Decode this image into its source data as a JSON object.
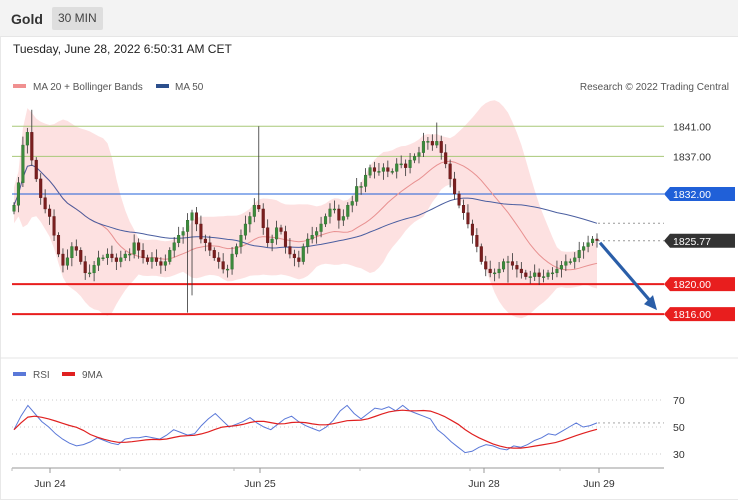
{
  "header": {
    "symbol": "Gold",
    "timeframe": "30 MIN",
    "timestamp": "Tuesday, June 28, 2022 6:50:31 AM CET"
  },
  "legend": {
    "ma20": "MA 20 + Bollinger Bands",
    "ma50": "MA 50",
    "credit": "Research © 2022 Trading Central",
    "rsi": "RSI",
    "rsi_ma": "9MA"
  },
  "colors": {
    "bands_fill": "#fddcdc",
    "ma20": "#e89090",
    "ma50": "#4a5ea0",
    "resistance_green": "#a8c878",
    "blue_level": "#2060d8",
    "support_red": "#e81e1e",
    "current": "#333333",
    "candle": "#7a1f1f",
    "rsi": "#5a78d8",
    "rsi_ma": "#e02020",
    "arrow": "#2a5ea8"
  },
  "chart_data": [
    {
      "type": "candlestick",
      "title": "Gold",
      "timeframe": "30 MIN",
      "x_ticks": [
        "Jun 24",
        "Jun 25",
        "Jun 28",
        "Jun 29"
      ],
      "ylim": [
        1811.5,
        1844.5
      ],
      "levels": [
        {
          "value": 1841.0,
          "label": "1841.00",
          "style": "green"
        },
        {
          "value": 1837.0,
          "label": "1837.00",
          "style": "green"
        },
        {
          "value": 1832.0,
          "label": "1832.00",
          "style": "blue"
        },
        {
          "value": 1825.77,
          "label": "1825.77",
          "style": "current"
        },
        {
          "value": 1820.0,
          "label": "1820.00",
          "style": "red"
        },
        {
          "value": 1816.0,
          "label": "1816.00",
          "style": "red"
        }
      ],
      "forecast_arrow": {
        "from": 1825.77,
        "to": 1816.0,
        "direction": "down"
      },
      "close_series": [
        1830.5,
        1833.5,
        1838.5,
        1840.2,
        1836.5,
        1834.0,
        1831.5,
        1830.0,
        1829.0,
        1826.5,
        1824.0,
        1822.5,
        1823.5,
        1825.0,
        1824.5,
        1823.0,
        1821.5,
        1821.5,
        1822.5,
        1823.5,
        1823.5,
        1824.0,
        1823.5,
        1823.0,
        1823.5,
        1824.0,
        1824.0,
        1825.5,
        1824.5,
        1823.5,
        1823.0,
        1823.5,
        1823.0,
        1822.5,
        1823.0,
        1824.5,
        1825.5,
        1826.5,
        1827.0,
        1828.5,
        1829.5,
        1828.0,
        1826.0,
        1825.5,
        1824.5,
        1823.5,
        1823.0,
        1822.0,
        1822.0,
        1824.0,
        1825.0,
        1826.5,
        1828.0,
        1829.0,
        1830.5,
        1830.0,
        1827.5,
        1825.5,
        1826.0,
        1827.5,
        1827.0,
        1825.0,
        1824.0,
        1823.5,
        1823.0,
        1825.0,
        1826.0,
        1826.5,
        1827.0,
        1828.0,
        1829.0,
        1830.0,
        1830.0,
        1828.5,
        1829.0,
        1830.5,
        1831.0,
        1833.0,
        1833.0,
        1834.5,
        1835.5,
        1835.0,
        1835.0,
        1835.5,
        1835.0,
        1835.0,
        1836.0,
        1836.0,
        1835.5,
        1836.5,
        1837.0,
        1837.5,
        1839.0,
        1839.0,
        1838.5,
        1839.0,
        1837.5,
        1836.0,
        1834.0,
        1832.0,
        1830.5,
        1829.5,
        1828.0,
        1826.5,
        1825.0,
        1823.0,
        1822.0,
        1821.5,
        1821.5,
        1822.0,
        1823.0,
        1823.0,
        1822.5,
        1822.0,
        1821.5,
        1821.0,
        1821.0,
        1821.5,
        1821.0,
        1821.0,
        1821.5,
        1821.5,
        1822.0,
        1822.5,
        1823.0,
        1823.0,
        1823.5,
        1824.5,
        1825.0,
        1825.5,
        1826.0,
        1825.8
      ],
      "series_names": [
        "MA 20 + Bollinger Bands",
        "MA 50"
      ]
    },
    {
      "type": "line",
      "series_names": [
        "RSI",
        "9MA"
      ],
      "y_ticks": [
        "70",
        "50",
        "30"
      ],
      "ylim": [
        25,
        75
      ],
      "rsi": [
        48,
        58,
        66,
        60,
        54,
        50,
        45,
        41,
        38,
        36,
        37,
        39,
        42,
        40,
        38,
        37,
        41,
        42,
        42,
        43,
        42,
        41,
        44,
        48,
        46,
        44,
        45,
        51,
        56,
        60,
        55,
        50,
        52,
        54,
        57,
        53,
        50,
        48,
        52,
        56,
        58,
        54,
        51,
        49,
        47,
        50,
        55,
        62,
        66,
        60,
        56,
        60,
        64,
        63,
        65,
        62,
        66,
        62,
        60,
        58,
        56,
        48,
        44,
        39,
        35,
        31,
        32,
        35,
        37,
        36,
        34,
        33,
        36,
        35,
        37,
        40,
        42,
        45,
        44,
        47,
        50,
        53,
        50,
        51,
        53
      ]
    }
  ]
}
